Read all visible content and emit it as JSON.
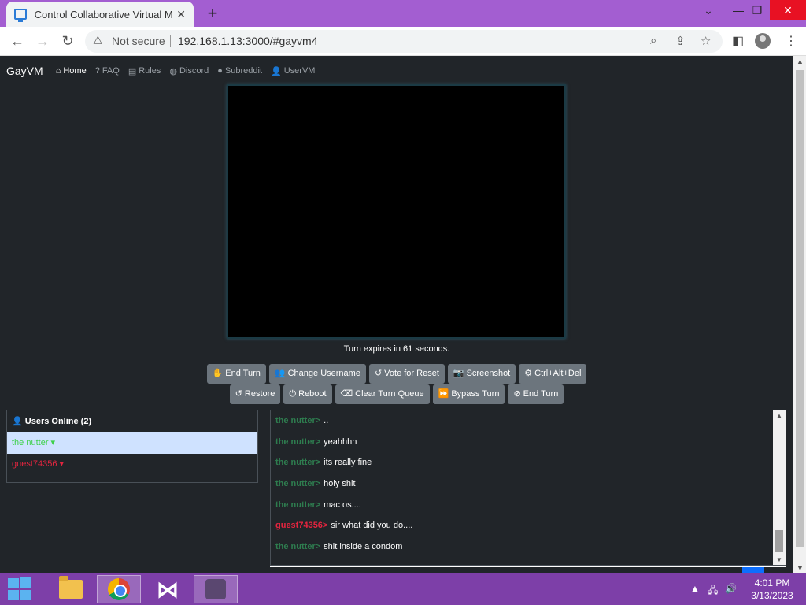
{
  "browser": {
    "tab_title": "Control Collaborative Virtual Machine",
    "tab_close": "✕",
    "new_tab": "+",
    "not_secure": "Not secure",
    "url": "192.168.1.13:3000/#gayvm4",
    "window_controls": {
      "minimize": "⌄",
      "restore_tabs": "—",
      "maximize": "❐",
      "close": "✕"
    }
  },
  "navbar": {
    "brand": "GayVM",
    "links": [
      {
        "label": "Home",
        "icon": "⌂"
      },
      {
        "label": "FAQ",
        "icon": "?"
      },
      {
        "label": "Rules",
        "icon": "▤"
      },
      {
        "label": "Discord",
        "icon": "◍"
      },
      {
        "label": "Subreddit",
        "icon": "●"
      },
      {
        "label": "UserVM",
        "icon": "👤"
      }
    ]
  },
  "vm": {
    "turn_message": "Turn expires in 61 seconds."
  },
  "buttons_row1": [
    {
      "label": "End Turn",
      "icon": "✋"
    },
    {
      "label": "Change Username",
      "icon": "👥"
    },
    {
      "label": "Vote for Reset",
      "icon": "↺"
    },
    {
      "label": "Screenshot",
      "icon": "📷"
    },
    {
      "label": "Ctrl+Alt+Del",
      "icon": "⚙"
    }
  ],
  "buttons_row2": [
    {
      "label": "Restore",
      "icon": "↺"
    },
    {
      "label": "Reboot",
      "icon": "⏻"
    },
    {
      "label": "Clear Turn Queue",
      "icon": "⌫"
    },
    {
      "label": "Bypass Turn",
      "icon": "⏩"
    },
    {
      "label": "End Turn",
      "icon": "⊘"
    }
  ],
  "users": {
    "header": "Users Online (2)",
    "header_icon": "👤",
    "list": [
      {
        "name": "the nutter ▾"
      },
      {
        "name": "guest74356 ▾"
      }
    ]
  },
  "chat": {
    "messages": [
      {
        "user": "the nutter>",
        "text": ".."
      },
      {
        "user": "the nutter>",
        "text": "yeahhhh"
      },
      {
        "user": "the nutter>",
        "text": "its really fine"
      },
      {
        "user": "the nutter>",
        "text": "holy shit"
      },
      {
        "user": "the nutter>",
        "text": "mac os...."
      },
      {
        "user": "guest74356>",
        "text": "sir what did you do...."
      },
      {
        "user": "the nutter>",
        "text": "shit inside a condom"
      }
    ]
  },
  "taskbar": {
    "time": "4:01 PM",
    "date": "3/13/2023"
  },
  "colors": {
    "page_bg": "#212529",
    "tabstrip": "#a35ed1",
    "taskbar": "#7d3fa8",
    "button": "#6c757d",
    "user_selected_bg": "#cfe2ff",
    "nutter_green": "#2e7d4f",
    "guest_red": "#e4253f"
  }
}
